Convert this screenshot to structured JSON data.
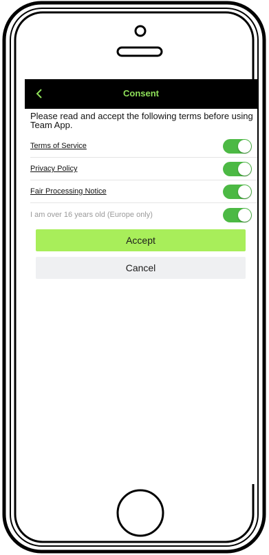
{
  "navbar": {
    "title": "Consent",
    "back_icon": "chevron-left-icon"
  },
  "intro_text": "Please read and accept the following terms before using Team App.",
  "consents": [
    {
      "label": "Terms of Service",
      "on": true,
      "linked": true
    },
    {
      "label": "Privacy Policy",
      "on": true,
      "linked": true
    },
    {
      "label": "Fair Processing Notice",
      "on": true,
      "linked": true
    },
    {
      "label": "I am over 16 years old (Europe only)",
      "on": true,
      "linked": false
    }
  ],
  "buttons": {
    "accept_label": "Accept",
    "cancel_label": "Cancel"
  },
  "colors": {
    "accent": "#8fe15a",
    "toggle_on": "#4cb944",
    "accept_bg": "#a8ee5a",
    "cancel_bg": "#eff0f2",
    "navbar_bg": "#000000"
  }
}
